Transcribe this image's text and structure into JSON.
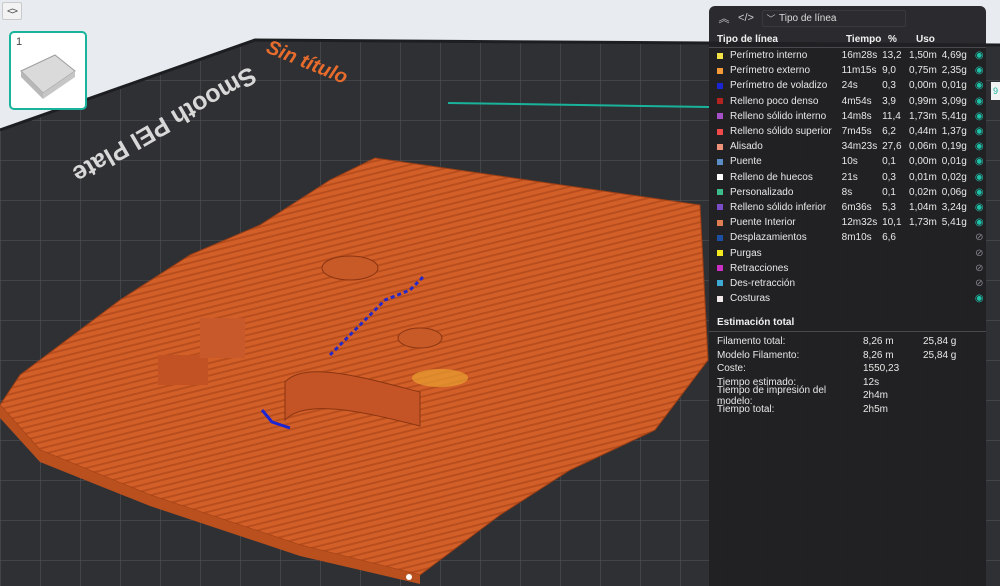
{
  "toolbar": {
    "collapse_icon": "<>"
  },
  "thumbnail": {
    "plate_number": "1"
  },
  "plate": {
    "title": "Sin título",
    "name": "Smooth PEI Plate"
  },
  "edge_tag": "9",
  "colors": {
    "accent": "#19b39b",
    "model": "#d9642c",
    "bed": "#2e2f33"
  },
  "panel": {
    "header": {
      "expand_icon": "chevron-up-double-icon",
      "code_icon": "code-icon",
      "view_type": "Tipo de línea"
    },
    "columns": {
      "type": "Tipo de línea",
      "time": "Tiempo",
      "percent": "%",
      "usage": "Uso"
    },
    "rows": [
      {
        "name": "Perímetro interno",
        "color": "#f3e245",
        "time": "16m28s",
        "percent": "13,2",
        "meters": "1,50m",
        "grams": "4,69g",
        "visible": true
      },
      {
        "name": "Perímetro externo",
        "color": "#f79a3a",
        "time": "11m15s",
        "percent": "9,0",
        "meters": "0,75m",
        "grams": "2,35g",
        "visible": true
      },
      {
        "name": "Perímetro de voladizo",
        "color": "#1a25d4",
        "time": "24s",
        "percent": "0,3",
        "meters": "0,00m",
        "grams": "0,01g",
        "visible": true
      },
      {
        "name": "Relleno poco denso",
        "color": "#b3231f",
        "time": "4m54s",
        "percent": "3,9",
        "meters": "0,99m",
        "grams": "3,09g",
        "visible": true
      },
      {
        "name": "Relleno sólido interno",
        "color": "#a550c8",
        "time": "14m8s",
        "percent": "11,4",
        "meters": "1,73m",
        "grams": "5,41g",
        "visible": true
      },
      {
        "name": "Relleno sólido superior",
        "color": "#f04a4a",
        "time": "7m45s",
        "percent": "6,2",
        "meters": "0,44m",
        "grams": "1,37g",
        "visible": true
      },
      {
        "name": "Alisado",
        "color": "#f19378",
        "time": "34m23s",
        "percent": "27,6",
        "meters": "0,06m",
        "grams": "0,19g",
        "visible": true
      },
      {
        "name": "Puente",
        "color": "#5b8ec5",
        "time": "10s",
        "percent": "0,1",
        "meters": "0,00m",
        "grams": "0,01g",
        "visible": true
      },
      {
        "name": "Relleno de huecos",
        "color": "#ffffff",
        "time": "21s",
        "percent": "0,3",
        "meters": "0,01m",
        "grams": "0,02g",
        "visible": true
      },
      {
        "name": "Personalizado",
        "color": "#3bbd8a",
        "time": "8s",
        "percent": "0,1",
        "meters": "0,02m",
        "grams": "0,06g",
        "visible": true
      },
      {
        "name": "Relleno sólido inferior",
        "color": "#7a4cc6",
        "time": "6m36s",
        "percent": "5,3",
        "meters": "1,04m",
        "grams": "3,24g",
        "visible": true
      },
      {
        "name": "Puente Interior",
        "color": "#e07d53",
        "time": "12m32s",
        "percent": "10,1",
        "meters": "1,73m",
        "grams": "5,41g",
        "visible": true
      },
      {
        "name": "Desplazamientos",
        "color": "#1b4fa1",
        "time": "8m10s",
        "percent": "6,6",
        "meters": "",
        "grams": "",
        "visible": false
      },
      {
        "name": "Purgas",
        "color": "#f4e81f",
        "time": "",
        "percent": "",
        "meters": "",
        "grams": "",
        "visible": false
      },
      {
        "name": "Retracciones",
        "color": "#cc2fc6",
        "time": "",
        "percent": "",
        "meters": "",
        "grams": "",
        "visible": false
      },
      {
        "name": "Des-retracción",
        "color": "#3fa9d6",
        "time": "",
        "percent": "",
        "meters": "",
        "grams": "",
        "visible": false
      },
      {
        "name": "Costuras",
        "color": "#f0e8e8",
        "time": "",
        "percent": "",
        "meters": "",
        "grams": "",
        "visible": true
      }
    ],
    "estimate": {
      "title": "Estimación total",
      "rows": [
        {
          "label": "Filamento total:",
          "v1": "8,26 m",
          "v2": "25,84 g"
        },
        {
          "label": "Modelo Filamento:",
          "v1": "8,26 m",
          "v2": "25,84 g"
        },
        {
          "label": "Coste:",
          "v1": "1550,23",
          "v2": ""
        },
        {
          "label": "Tiempo estimado:",
          "v1": "12s",
          "v2": ""
        },
        {
          "label": "Tiempo de impresión del modelo:",
          "v1": "2h4m",
          "v2": ""
        },
        {
          "label": "Tiempo total:",
          "v1": "2h5m",
          "v2": ""
        }
      ]
    }
  }
}
